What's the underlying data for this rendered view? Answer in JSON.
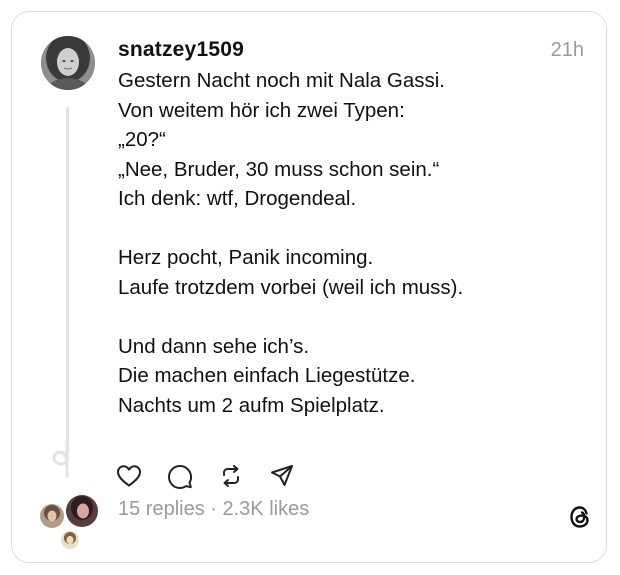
{
  "post": {
    "username": "snatzey1509",
    "timestamp": "21h",
    "lines": [
      "Gestern Nacht noch mit Nala Gassi.",
      "Von weitem hör ich zwei Typen:",
      "„20?“",
      "„Nee, Bruder, 30 muss schon sein.“",
      "Ich denk: wtf, Drogendeal.",
      "",
      "Herz pocht, Panik incoming.",
      "Laufe trotzdem vorbei (weil ich muss).",
      "",
      "Und dann sehe ich’s.",
      "Die machen einfach Liegestütze.",
      "Nachts um 2 aufm Spielplatz."
    ]
  },
  "actions": {
    "like_icon": "heart-icon",
    "reply_icon": "comment-icon",
    "repost_icon": "repost-icon",
    "share_icon": "share-icon"
  },
  "stats": {
    "replies": "15 replies",
    "separator": " · ",
    "likes": "2.3K likes"
  },
  "colors": {
    "text": "#111111",
    "muted": "#9a9a9a",
    "border": "#dcdcdc",
    "thread_line": "#e3e3e3"
  },
  "brand_icon": "threads-logo-icon"
}
